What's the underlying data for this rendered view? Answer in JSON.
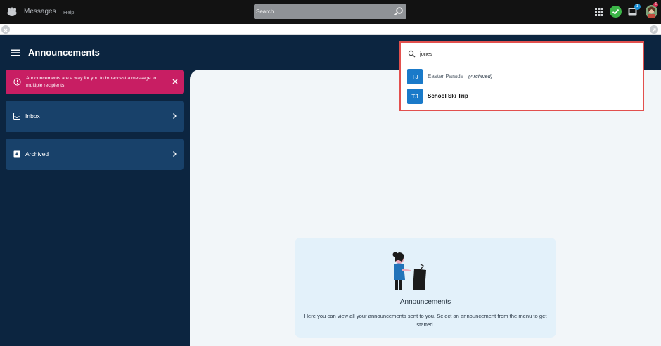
{
  "topbar": {
    "app_title": "Messages",
    "help_label": "Help",
    "search_placeholder": "Search",
    "inbox_badge": "1",
    "avatar_badge": "6"
  },
  "header": {
    "title": "Announcements"
  },
  "alert": {
    "text": "Announcements are a way for you to broadcast a message to multiple recipients."
  },
  "nav": {
    "items": [
      {
        "label": "Inbox",
        "icon": "inbox-icon"
      },
      {
        "label": "Archived",
        "icon": "archive-icon"
      }
    ]
  },
  "dropdown": {
    "query": "jones",
    "results": [
      {
        "initials": "TJ",
        "name": "Easter Parade",
        "tag": "(Archived)"
      },
      {
        "initials": "TJ",
        "name": "School Ski Trip"
      }
    ]
  },
  "empty_state": {
    "title": "Announcements",
    "description": "Here you can view all your announcements sent to you. Select an announcement from the menu to get started."
  },
  "colors": {
    "topbar": "#121212",
    "navy": "#0c2540",
    "nav_item": "#18416a",
    "alert": "#c81e63",
    "accent_blue": "#1a7ac9",
    "highlight_border": "#e2504e",
    "status_green": "#3cb648"
  }
}
